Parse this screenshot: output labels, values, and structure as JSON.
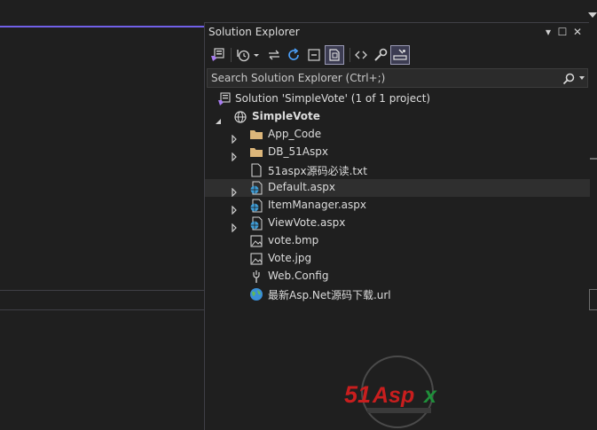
{
  "panel": {
    "title": "Solution Explorer",
    "title_buttons": [
      "▾",
      "☐",
      "✕"
    ]
  },
  "toolbar": {
    "icons": [
      "home-icon",
      "history-icon",
      "sync-icon",
      "refresh-icon",
      "collapse-all-icon",
      "show-all-files-icon",
      "view-code-icon",
      "properties-icon",
      "preview-icon"
    ]
  },
  "search": {
    "placeholder": "Search Solution Explorer (Ctrl+;)"
  },
  "tree": {
    "solution": "Solution 'SimpleVote' (1 of 1 project)",
    "project": "SimpleVote",
    "items": [
      {
        "label": "App_Code",
        "icon": "folder-icon",
        "expandable": true
      },
      {
        "label": "DB_51Aspx",
        "icon": "folder-icon",
        "expandable": true
      },
      {
        "label": "51aspx源码必读.txt",
        "icon": "text-file-icon",
        "expandable": false
      },
      {
        "label": "Default.aspx",
        "icon": "aspx-file-icon",
        "expandable": true,
        "selected": true
      },
      {
        "label": "ItemManager.aspx",
        "icon": "aspx-file-icon",
        "expandable": true
      },
      {
        "label": "ViewVote.aspx",
        "icon": "aspx-file-icon",
        "expandable": true
      },
      {
        "label": "vote.bmp",
        "icon": "image-file-icon",
        "expandable": false
      },
      {
        "label": "Vote.jpg",
        "icon": "image-file-icon",
        "expandable": false
      },
      {
        "label": "Web.Config",
        "icon": "config-file-icon",
        "expandable": false
      },
      {
        "label": "最新Asp.Net源码下载.url",
        "icon": "url-file-icon",
        "expandable": false
      }
    ]
  },
  "watermark": {
    "brand": "51Aspx"
  },
  "colors": {
    "accent": "#7160e8",
    "background": "#1f1f1f",
    "selection": "#2f2f2f",
    "folder": "#dcb67a",
    "aspx": "#3f9ed8"
  }
}
